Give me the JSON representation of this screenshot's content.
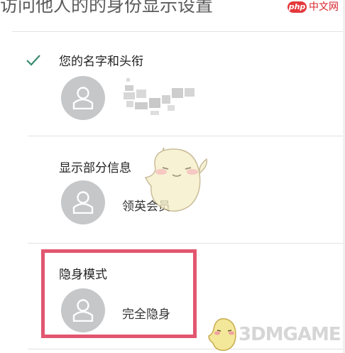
{
  "header": {
    "title": "访问他人的的身份显示设置"
  },
  "watermarks": {
    "php_badge": "php",
    "php_cn": "中文网",
    "bottom_right": "3DMGAME"
  },
  "options": [
    {
      "label": "您的名字和头衔",
      "value": "",
      "selected": true
    },
    {
      "label": "显示部分信息",
      "value": "领英会员",
      "selected": false
    },
    {
      "label": "隐身模式",
      "value": "完全隐身",
      "selected": false,
      "highlighted": true
    }
  ],
  "colors": {
    "check": "#3b8a6f",
    "highlight_border": "#e2566f",
    "avatar_bg": "#c6c7c9"
  }
}
